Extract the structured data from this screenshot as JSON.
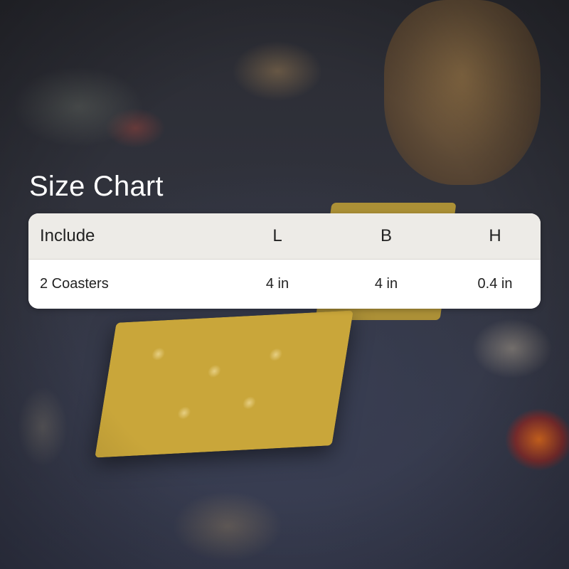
{
  "title": "Size Chart",
  "table": {
    "headers": [
      "Include",
      "L",
      "B",
      "H"
    ],
    "rows": [
      [
        "2 Coasters",
        "4 in",
        "4 in",
        "0.4 in"
      ]
    ]
  }
}
